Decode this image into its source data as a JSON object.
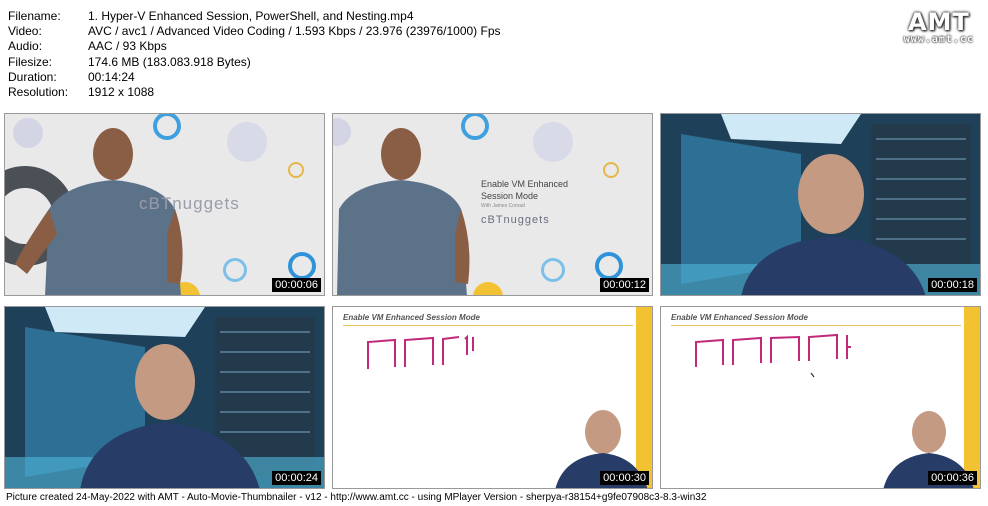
{
  "meta": {
    "filename_label": "Filename:",
    "filename": "1. Hyper-V Enhanced Session, PowerShell, and Nesting.mp4",
    "video_label": "Video:",
    "video": "AVC / avc1 / Advanced Video Coding / 1.593 Kbps / 23.976 (23976/1000) Fps",
    "audio_label": "Audio:",
    "audio": "AAC / 93 Kbps",
    "filesize_label": "Filesize:",
    "filesize": "174.6 MB (183.083.918 Bytes)",
    "duration_label": "Duration:",
    "duration": "00:14:24",
    "resolution_label": "Resolution:",
    "resolution": "1912 x 1088"
  },
  "logo": {
    "text": "AMT",
    "url": "www.amt.cc"
  },
  "thumbs": [
    {
      "time": "00:00:06",
      "brand": "cBTnuggets"
    },
    {
      "time": "00:00:12",
      "title_line1": "Enable VM Enhanced",
      "title_line2": "Session Mode",
      "subtitle": "With James Conrad",
      "brand": "cBTnuggets"
    },
    {
      "time": "00:00:18"
    },
    {
      "time": "00:00:24"
    },
    {
      "time": "00:00:30",
      "header": "Enable VM Enhanced Session Mode"
    },
    {
      "time": "00:00:36",
      "header": "Enable VM Enhanced Session Mode"
    }
  ],
  "footer": "Picture created 24-May-2022 with AMT - Auto-Movie-Thumbnailer - v12 - http://www.amt.cc - using MPlayer Version - sherpya-r38154+g9fe07908c3-8.3-win32"
}
